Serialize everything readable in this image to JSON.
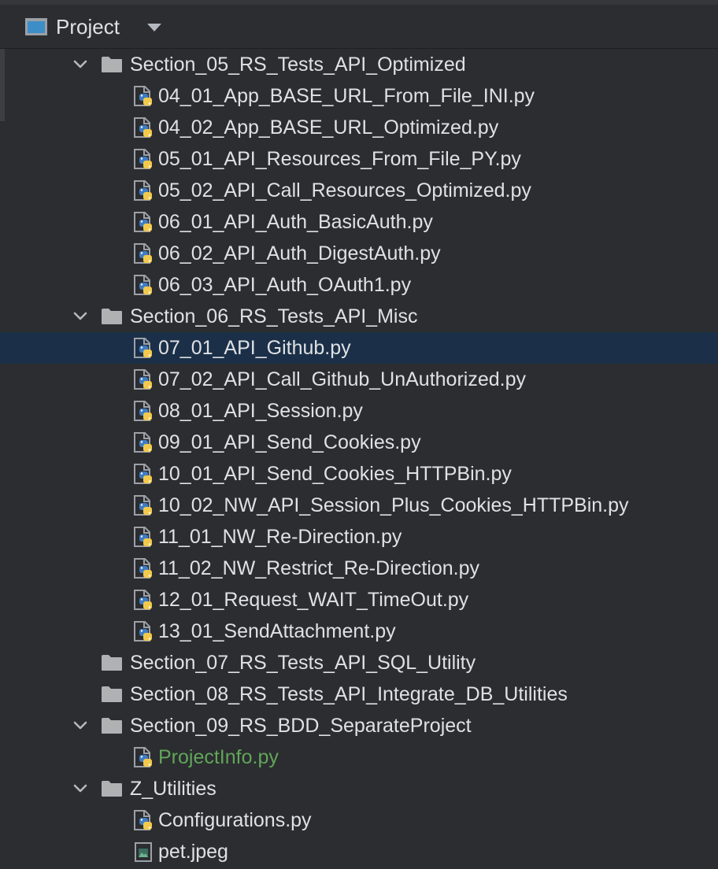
{
  "header": {
    "title": "Project",
    "title_icon": "project-window-icon",
    "dropdown_icon": "chevron-down-icon"
  },
  "colors": {
    "background": "#2b2d30",
    "selection": "#1b3048",
    "text": "#dfe1e5",
    "new_file_text": "#62a55a",
    "folder": "#afb1b3",
    "python_blue": "#3f7cc2",
    "python_yellow": "#f2c94c"
  },
  "tree": [
    {
      "type": "folder",
      "level": 0,
      "expanded": true,
      "label": "Section_05_RS_Tests_API_Optimized"
    },
    {
      "type": "py",
      "level": 1,
      "label": "04_01_App_BASE_URL_From_File_INI.py"
    },
    {
      "type": "py",
      "level": 1,
      "label": "04_02_App_BASE_URL_Optimized.py"
    },
    {
      "type": "py",
      "level": 1,
      "label": "05_01_API_Resources_From_File_PY.py"
    },
    {
      "type": "py",
      "level": 1,
      "label": "05_02_API_Call_Resources_Optimized.py"
    },
    {
      "type": "py",
      "level": 1,
      "label": "06_01_API_Auth_BasicAuth.py"
    },
    {
      "type": "py",
      "level": 1,
      "label": "06_02_API_Auth_DigestAuth.py"
    },
    {
      "type": "py",
      "level": 1,
      "label": "06_03_API_Auth_OAuth1.py"
    },
    {
      "type": "folder",
      "level": 0,
      "expanded": true,
      "label": "Section_06_RS_Tests_API_Misc"
    },
    {
      "type": "py",
      "level": 1,
      "selected": true,
      "label": "07_01_API_Github.py"
    },
    {
      "type": "py",
      "level": 1,
      "label": "07_02_API_Call_Github_UnAuthorized.py"
    },
    {
      "type": "py",
      "level": 1,
      "label": "08_01_API_Session.py"
    },
    {
      "type": "py",
      "level": 1,
      "label": "09_01_API_Send_Cookies.py"
    },
    {
      "type": "py",
      "level": 1,
      "label": "10_01_API_Send_Cookies_HTTPBin.py"
    },
    {
      "type": "py",
      "level": 1,
      "label": "10_02_NW_API_Session_Plus_Cookies_HTTPBin.py"
    },
    {
      "type": "py",
      "level": 1,
      "label": "11_01_NW_Re-Direction.py"
    },
    {
      "type": "py",
      "level": 1,
      "label": "11_02_NW_Restrict_Re-Direction.py"
    },
    {
      "type": "py",
      "level": 1,
      "label": "12_01_Request_WAIT_TimeOut.py"
    },
    {
      "type": "py",
      "level": 1,
      "label": "13_01_SendAttachment.py"
    },
    {
      "type": "folder",
      "level": 0,
      "expanded": false,
      "label": "Section_07_RS_Tests_API_SQL_Utility"
    },
    {
      "type": "folder",
      "level": 0,
      "expanded": false,
      "label": "Section_08_RS_Tests_API_Integrate_DB_Utilities"
    },
    {
      "type": "folder",
      "level": 0,
      "expanded": true,
      "label": "Section_09_RS_BDD_SeparateProject"
    },
    {
      "type": "py",
      "level": 1,
      "status": "new",
      "label": "ProjectInfo.py"
    },
    {
      "type": "folder",
      "level": 0,
      "expanded": true,
      "label": "Z_Utilities"
    },
    {
      "type": "py",
      "level": 1,
      "label": "Configurations.py"
    },
    {
      "type": "image",
      "level": 1,
      "label": "pet.jpeg"
    }
  ]
}
